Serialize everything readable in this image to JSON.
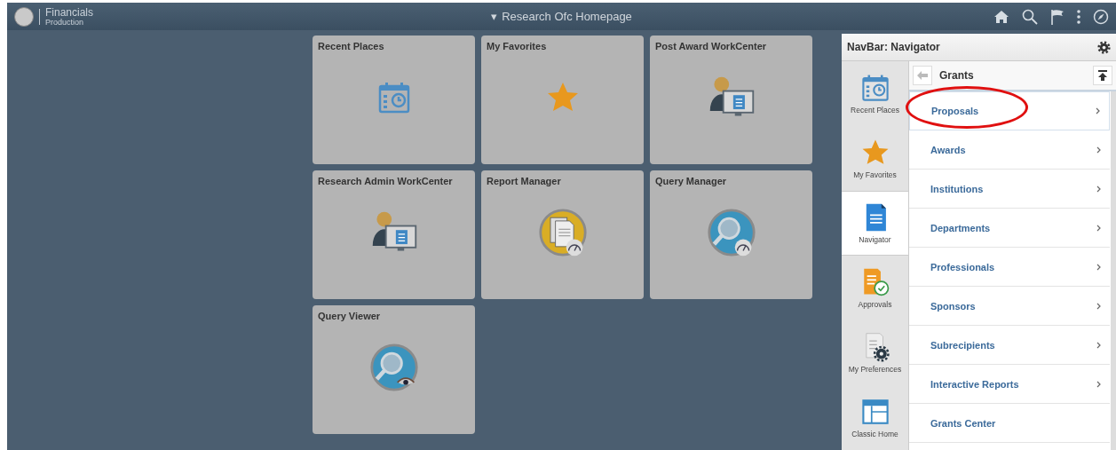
{
  "header": {
    "app_name": "Financials",
    "environment": "Production",
    "title_caret": "▾",
    "title": "Research Ofc Homepage"
  },
  "tiles": [
    {
      "title": "Recent Places",
      "kind": "calendar"
    },
    {
      "title": "My Favorites",
      "kind": "star"
    },
    {
      "title": "Post Award WorkCenter",
      "kind": "workcenter"
    },
    {
      "title": "Research Admin WorkCenter",
      "kind": "workcenter"
    },
    {
      "title": "Report Manager",
      "kind": "report"
    },
    {
      "title": "Query Manager",
      "kind": "query"
    },
    {
      "title": "Query Viewer",
      "kind": "viewer"
    }
  ],
  "navbar": {
    "title": "NavBar: Navigator",
    "tabs": [
      {
        "label": "Recent Places",
        "kind": "calendar",
        "selected": false
      },
      {
        "label": "My Favorites",
        "kind": "star",
        "selected": false
      },
      {
        "label": "Navigator",
        "kind": "navigator",
        "selected": true
      },
      {
        "label": "Approvals",
        "kind": "approvals",
        "selected": false
      },
      {
        "label": "My Preferences",
        "kind": "preferences",
        "selected": false
      },
      {
        "label": "Classic Home",
        "kind": "classic",
        "selected": false
      }
    ],
    "breadcrumb": "Grants",
    "items": [
      {
        "label": "Proposals",
        "has_children": true,
        "circled": true
      },
      {
        "label": "Awards",
        "has_children": true,
        "circled": false
      },
      {
        "label": "Institutions",
        "has_children": true,
        "circled": false
      },
      {
        "label": "Departments",
        "has_children": true,
        "circled": false
      },
      {
        "label": "Professionals",
        "has_children": true,
        "circled": false
      },
      {
        "label": "Sponsors",
        "has_children": true,
        "circled": false
      },
      {
        "label": "Subrecipients",
        "has_children": true,
        "circled": false
      },
      {
        "label": "Interactive Reports",
        "has_children": true,
        "circled": false
      },
      {
        "label": "Grants Center",
        "has_children": false,
        "circled": false
      }
    ]
  }
}
